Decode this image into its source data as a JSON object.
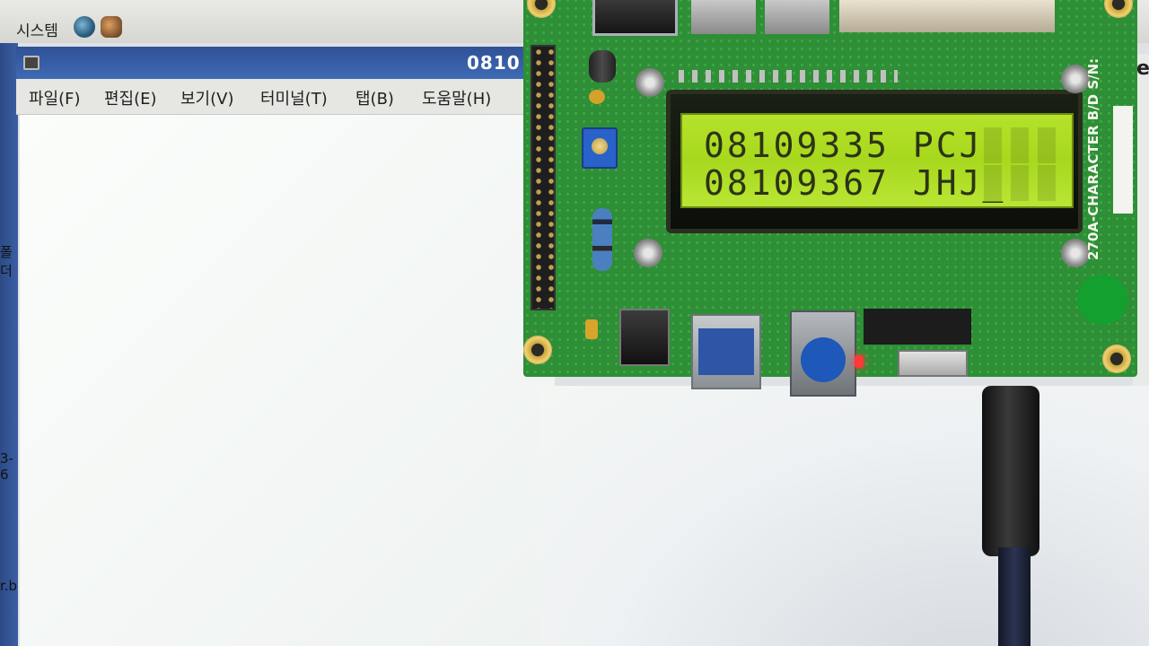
{
  "top_panel": {
    "system_menu": "시스템"
  },
  "terminal_window": {
    "title": "0810",
    "menu": [
      "파일(F)",
      "편집(E)",
      "보기(V)",
      "터미널(T)",
      "탭(B)",
      "도움말(H)"
    ]
  },
  "left_strip": {
    "fragments": [
      "폴더",
      "3-6",
      "r.b"
    ]
  },
  "right_edge_text": "e",
  "lcd": {
    "line1": "08109335 PCJ",
    "line2": "08109367 JHJ_"
  },
  "board": {
    "silkscreen": "270A-CHARACTER B/D\nS/N:"
  },
  "colors": {
    "lcd_background": "#b4e22a",
    "lcd_text": "#2c3415",
    "board_green": "#2e8f36",
    "power_led": "#ff3838"
  }
}
